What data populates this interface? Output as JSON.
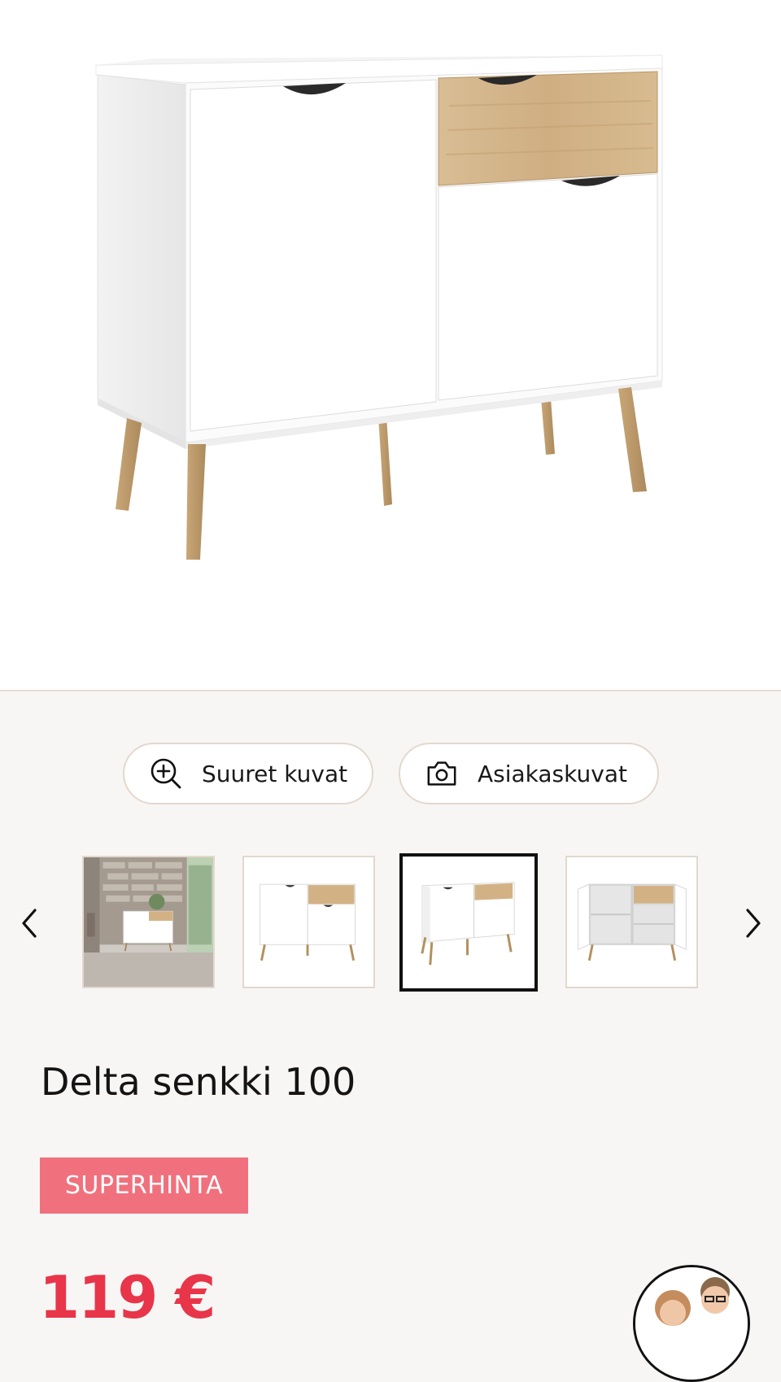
{
  "gallery": {
    "main_image_alt": "Delta senkki 100 main image",
    "buttons": {
      "large_images": "Suuret kuvat",
      "customer_images": "Asiakaskuvat"
    },
    "thumbnails": [
      {
        "label": "room view"
      },
      {
        "label": "front view"
      },
      {
        "label": "angled view",
        "selected": true
      },
      {
        "label": "open view"
      }
    ]
  },
  "product": {
    "name": "Delta senkki 100",
    "badge": "SUPERHINTA",
    "price": "119 €"
  },
  "colors": {
    "badge_bg": "#f0717d",
    "price": "#e8354a",
    "oak": "#d6b88f",
    "background": "#f8f6f4"
  },
  "icons": [
    "zoom-in-icon",
    "camera-icon",
    "chevron-left-icon",
    "chevron-right-icon"
  ]
}
